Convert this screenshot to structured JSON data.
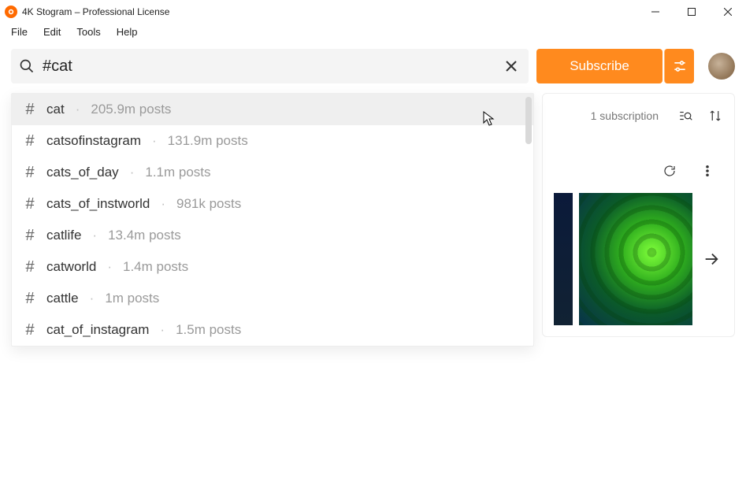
{
  "window": {
    "title": "4K Stogram – Professional License"
  },
  "menu": {
    "file": "File",
    "edit": "Edit",
    "tools": "Tools",
    "help": "Help"
  },
  "search": {
    "value": "#cat",
    "placeholder": ""
  },
  "subscribe": {
    "label": "Subscribe"
  },
  "info": {
    "subscriptions_text": "1 subscription"
  },
  "suggestions": [
    {
      "tag": "cat",
      "meta": "205.9m posts"
    },
    {
      "tag": "catsofinstagram",
      "meta": "131.9m posts"
    },
    {
      "tag": "cats_of_day",
      "meta": "1.1m posts"
    },
    {
      "tag": "cats_of_instworld",
      "meta": "981k posts"
    },
    {
      "tag": "catlife",
      "meta": "13.4m posts"
    },
    {
      "tag": "catworld",
      "meta": "1.4m posts"
    },
    {
      "tag": "cattle",
      "meta": "1m posts"
    },
    {
      "tag": "cat_of_instagram",
      "meta": "1.5m posts"
    }
  ]
}
